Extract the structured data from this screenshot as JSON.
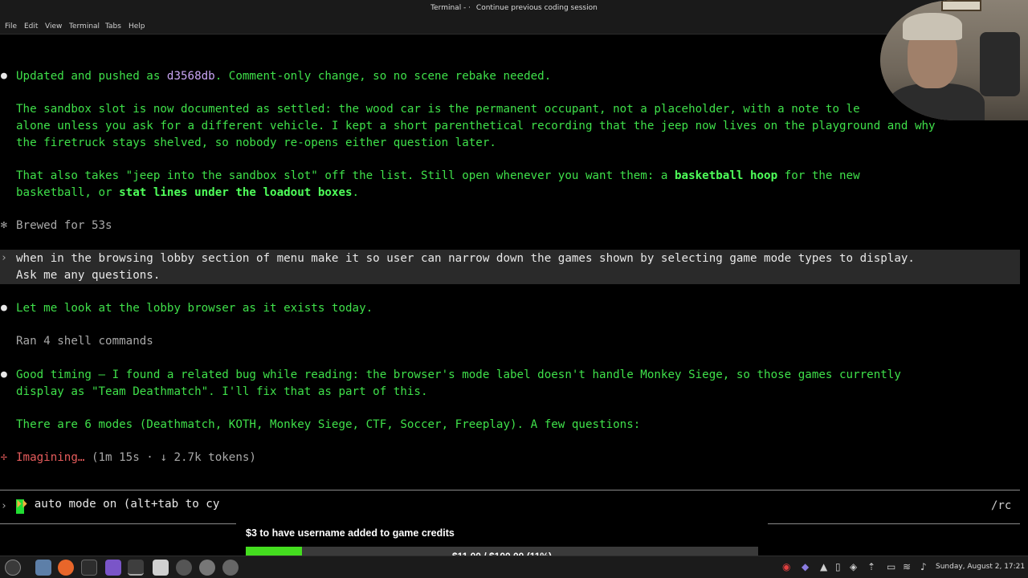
{
  "window": {
    "title_left": "Terminal - ·",
    "title_right": "Continue previous coding session"
  },
  "menu": [
    "File",
    "Edit",
    "View",
    "Terminal",
    "Tabs",
    "Help"
  ],
  "terminal": {
    "l1_a": "Updated and pushed as ",
    "l1_hash": "d3568db",
    "l1_b": ". Comment-only change, so no scene rebake needed.",
    "l2": "The sandbox slot is now documented as settled: the wood car is the permanent occupant, not a placeholder, with a note to le",
    "l3": "alone unless you ask for a different vehicle. I kept a short parenthetical recording that the jeep now lives on the playground and why",
    "l4": "the firetruck stays shelved, so nobody re-opens either question later.",
    "l5_a": "That also takes \"jeep into the sandbox slot\" off the list. Still open whenever you want them: a ",
    "l5_b": "basketball hoop",
    "l5_c": " for the new",
    "l6_a": "basketball, or ",
    "l6_b": "stat lines under the loadout boxes",
    "l6_c": ".",
    "brewed": "Brewed for 53s",
    "user1": "when in the browsing lobby section of menu make it so user can narrow down the games shown by selecting game mode types to display.",
    "user2": "Ask me any questions.",
    "l7": "Let me look at the lobby browser as it exists today.",
    "ran": "Ran 4 shell commands",
    "l8": "Good timing — I found a related bug while reading: the browser's mode label doesn't handle Monkey Siege, so those games currently",
    "l9": "display as \"Team Deathmatch\". I'll fix that as part of this.",
    "l10": "There are 6 modes (Deathmatch, KOTH, Monkey Siege, CTF, Soccer, Freeplay). A few questions:",
    "imag_a": "Imagining…",
    "imag_b": " (1m 15s · ↓ 2.7k tokens)",
    "status_arrows": "⏵⏵",
    "status_text": " auto mode on (alt+tab to cy",
    "rc": "/rc"
  },
  "donation": {
    "title": "$3 to have username added to game credits",
    "bar_text": "$11.00 / $100.00 (11%)",
    "progress": 0.11
  },
  "taskbar": {
    "clock": "Sunday, August  2, 17:21"
  }
}
